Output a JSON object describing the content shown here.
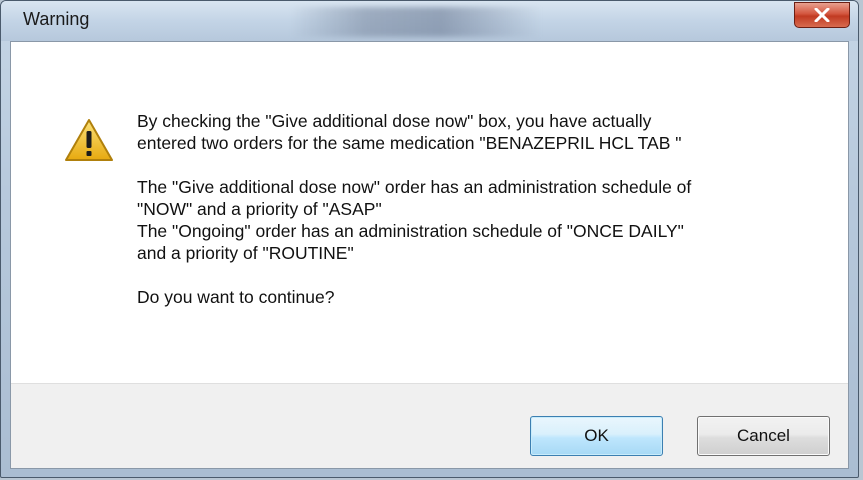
{
  "window": {
    "title": "Warning",
    "close_icon": "close-icon"
  },
  "dialog": {
    "icon": "warning-icon",
    "message": {
      "line1": "By checking the \"Give additional dose now\" box, you have actually",
      "line2": "entered two orders for the same medication \"BENAZEPRIL HCL TAB \"",
      "line3": "The \"Give additional dose now\" order has an administration schedule of",
      "line4": "\"NOW\" and a priority of \"ASAP\"",
      "line5": "The \"Ongoing\" order has an administration schedule of \"ONCE DAILY\"",
      "line6": "and a priority of \"ROUTINE\"",
      "line7": "Do you want to continue?"
    }
  },
  "buttons": {
    "ok_label": "OK",
    "cancel_label": "Cancel"
  },
  "colors": {
    "warning_fill": "#f2c22a",
    "close_button": "#c13a22",
    "default_button_border": "#3c7fb1"
  }
}
